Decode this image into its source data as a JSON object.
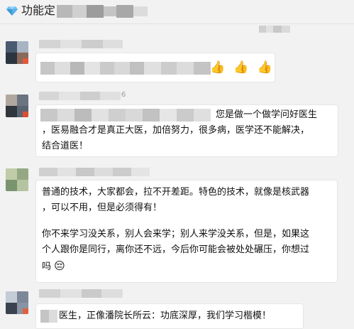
{
  "header": {
    "title": "功能定",
    "icon": "diamond-icon"
  },
  "timestamp": {
    "text": "一一"
  },
  "messages": [
    {
      "avatar": "blurred-avatar",
      "text": "",
      "thumbs": [
        "👍",
        "👍",
        "👍"
      ]
    },
    {
      "avatar": "blurred-avatar",
      "name_suffix": "6",
      "text": "您是做一个做学问好医生\n，医易融合才是真正大医，加倍努力，很多病，医学还不能解决，\n结合道医！"
    },
    {
      "avatar": "blurred-avatar",
      "paragraph1": "普通的技术，大家都会，拉不开差距。特色的技术，就像是核武器\n，可以不用，但是必须得有！",
      "paragraph2": "你不来学习没关系，别人会来学；别人来学没关系，但是，如果这\n个人跟你是同行，离你还不远，今后你可能会被处处碾压，你想过\n吗",
      "emoji": "😔"
    },
    {
      "avatar": "blurred-avatar",
      "text": "医生，正像潘院长所云：功底深厚，我们学习楷模！"
    }
  ],
  "colors": {
    "background": "#f2f2f2",
    "bubble": "#ffffff",
    "diamond": "#4aa3e0"
  }
}
